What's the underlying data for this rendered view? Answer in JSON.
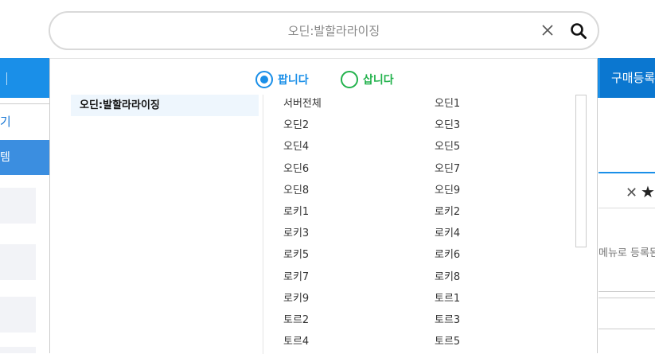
{
  "search": {
    "value": "오딘:발할라라이징",
    "clear_icon": "close-icon",
    "search_icon": "search-icon"
  },
  "background": {
    "buy_register_label": "구매등록",
    "left_link_text": "기",
    "left_tab_text": "템",
    "right_text": "메뉴로 등록된",
    "accent_color": "#1a8fe8"
  },
  "dropdown": {
    "radios": [
      {
        "label": "팝니다",
        "checked": true,
        "color": "#1a8fe8"
      },
      {
        "label": "삽니다",
        "checked": false,
        "color": "#22b24c"
      }
    ],
    "selected_game": "오딘:발할라라이징",
    "servers": [
      "서버전체",
      "오딘1",
      "오딘2",
      "오딘3",
      "오딘4",
      "오딘5",
      "오딘6",
      "오딘7",
      "오딘8",
      "오딘9",
      "로키1",
      "로키2",
      "로키3",
      "로키4",
      "로키5",
      "로키6",
      "로키7",
      "로키8",
      "로키9",
      "토르1",
      "토르2",
      "토르3",
      "토르4",
      "토르5"
    ]
  }
}
